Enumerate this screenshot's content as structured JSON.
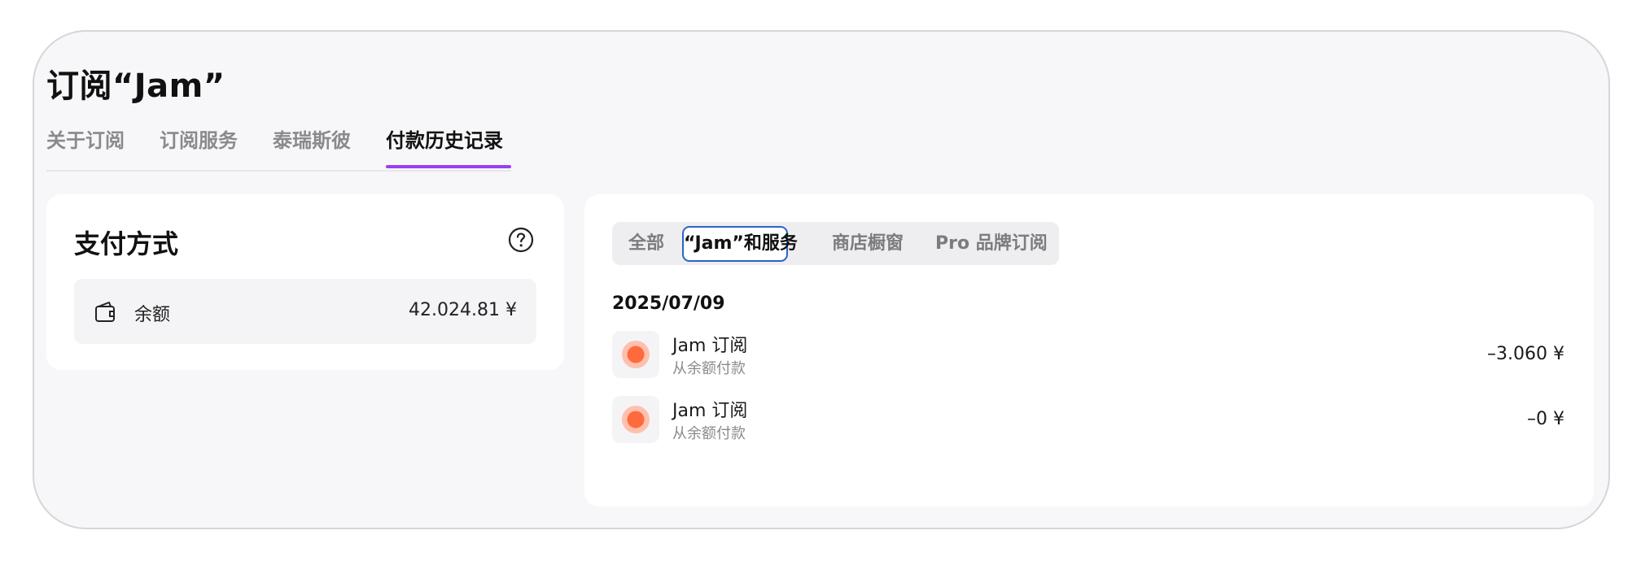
{
  "window": {
    "title": "订阅“Jam”"
  },
  "tabs": [
    {
      "label": "关于订阅",
      "active": false
    },
    {
      "label": "订阅服务",
      "active": false
    },
    {
      "label": "泰瑞斯彼",
      "active": false
    },
    {
      "label": "付款历史记录",
      "active": true
    }
  ],
  "payment_method": {
    "title": "支付方式",
    "help_icon": "question-circle-icon",
    "balance": {
      "icon": "wallet-icon",
      "label": "余额",
      "value": "42.024.81 ¥"
    }
  },
  "history": {
    "filters": [
      {
        "label": "全部",
        "selected": false
      },
      {
        "label": "“Jam”和服务",
        "selected": true
      },
      {
        "label": "商店橱窗",
        "selected": false
      },
      {
        "label": "Pro 品牌订阅",
        "selected": false
      }
    ],
    "groups": [
      {
        "date": "2025/07/09",
        "transactions": [
          {
            "title": "Jam 订阅",
            "subtitle": "从余额付款",
            "amount": "–3.060 ¥",
            "icon": "orange-dot-icon"
          },
          {
            "title": "Jam 订阅",
            "subtitle": "从余额付款",
            "amount": "–0 ¥",
            "icon": "orange-dot-icon"
          }
        ]
      }
    ]
  },
  "colors": {
    "accent_tab_underline": "#9b3df0",
    "selected_filter_border": "#2a64c9",
    "transaction_dot": "#ff6a3d"
  }
}
